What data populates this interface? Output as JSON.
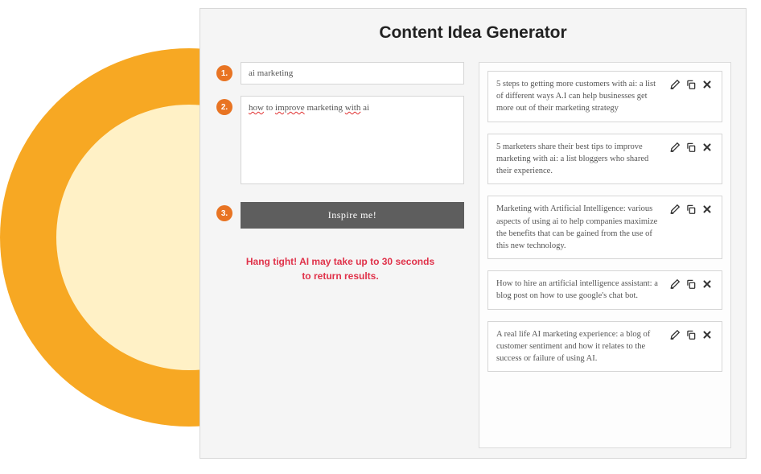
{
  "title": "Content Idea Generator",
  "steps": {
    "one": {
      "badge": "1.",
      "value": "ai marketing"
    },
    "two": {
      "badge": "2.",
      "value_parts": [
        "how",
        " to ",
        "improve",
        " marketing ",
        "with",
        " ai"
      ]
    },
    "three": {
      "badge": "3.",
      "button": "Inspire me!"
    }
  },
  "wait_message_l1": "Hang tight! AI may take up to 30 seconds",
  "wait_message_l2": "to return results.",
  "results": [
    "5 steps to getting more customers with ai: a list of different ways A.I can help businesses get more out of their marketing strategy",
    "5 marketers share their best tips to improve marketing with ai: a list bloggers who shared their experience.",
    "Marketing with Artificial Intelligence: various aspects of using ai to help companies maximize the benefits that can be gained from the use of this new technology.",
    "How to hire an artificial intelligence assistant: a blog post on how to use google's chat bot.",
    "A real life AI marketing experience: a blog of customer sentiment and how it relates to the success or failure of using AI."
  ],
  "icons": {
    "edit": "edit-icon",
    "copy": "copy-icon",
    "close": "close-icon"
  }
}
